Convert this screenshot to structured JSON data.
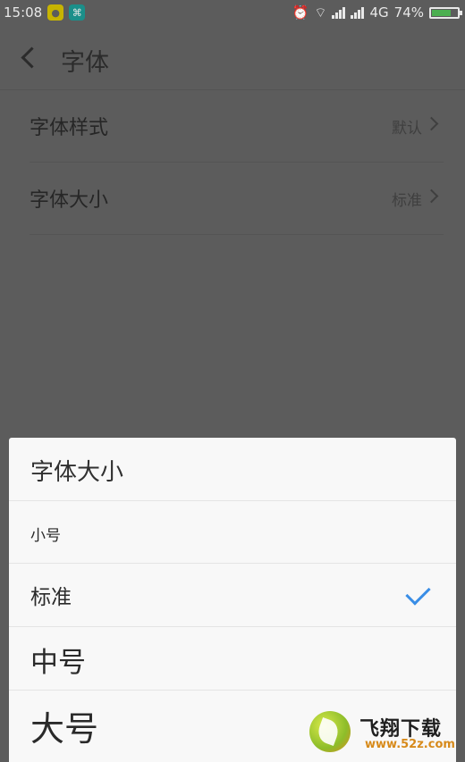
{
  "status_bar": {
    "time": "15:08",
    "network": "4G",
    "battery_percent": "74%",
    "battery_level": 0.74,
    "colors": {
      "battery_fill": "#4caf50",
      "text": "#e8e8e8"
    }
  },
  "header": {
    "title": "字体"
  },
  "settings": [
    {
      "label": "字体样式",
      "value": "默认"
    },
    {
      "label": "字体大小",
      "value": "标准"
    }
  ],
  "sheet": {
    "title": "字体大小",
    "options": [
      {
        "label": "小号",
        "selected": false
      },
      {
        "label": "标准",
        "selected": true
      },
      {
        "label": "中号",
        "selected": false
      },
      {
        "label": "大号",
        "selected": false
      }
    ],
    "check_color": "#3a8ee6"
  },
  "watermark": {
    "name": "飞翔下载",
    "url": "www.52z.com"
  }
}
